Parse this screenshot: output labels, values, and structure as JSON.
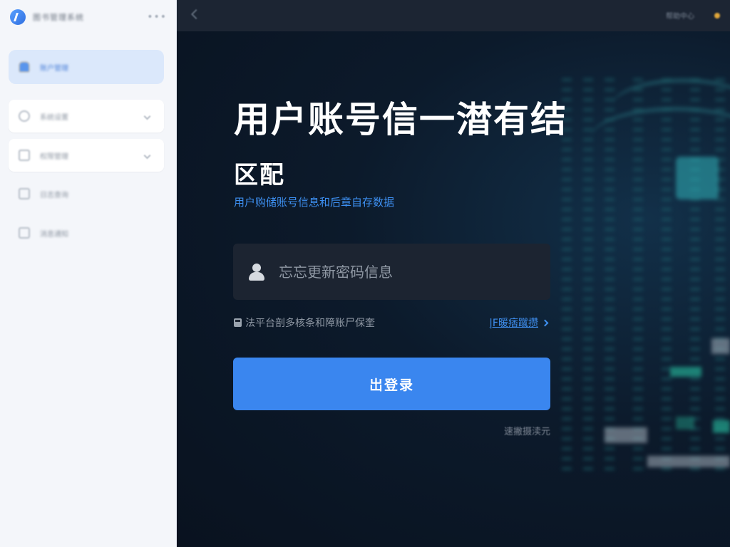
{
  "sidebar": {
    "app_name": "图书管理系统",
    "items": [
      {
        "label": "账户管理",
        "icon": "cloud-icon",
        "active": true
      },
      {
        "label": "系统设置",
        "icon": "chat-icon"
      },
      {
        "label": "权限管理",
        "icon": "document-icon"
      },
      {
        "label": "日志查询",
        "icon": "list-icon"
      },
      {
        "label": "消息通知",
        "icon": "folder-icon"
      }
    ]
  },
  "topbar": {
    "link": "帮助中心"
  },
  "login": {
    "title_line1": "用户账号信一澘有结",
    "title_line2": "区配",
    "subtitle": "用户购储账号信息和后章自存数据",
    "input_placeholder": "忘忘更新密码信息",
    "hint": "法平台剖多核条和障账尸保奎",
    "link": "|F暖痞蹴攒",
    "button": "岀登录",
    "footer": "速撇摄渎元"
  },
  "colors": {
    "accent": "#3a86ef",
    "sidebar_bg": "#f4f6fa",
    "main_bg": "#0b1626"
  }
}
